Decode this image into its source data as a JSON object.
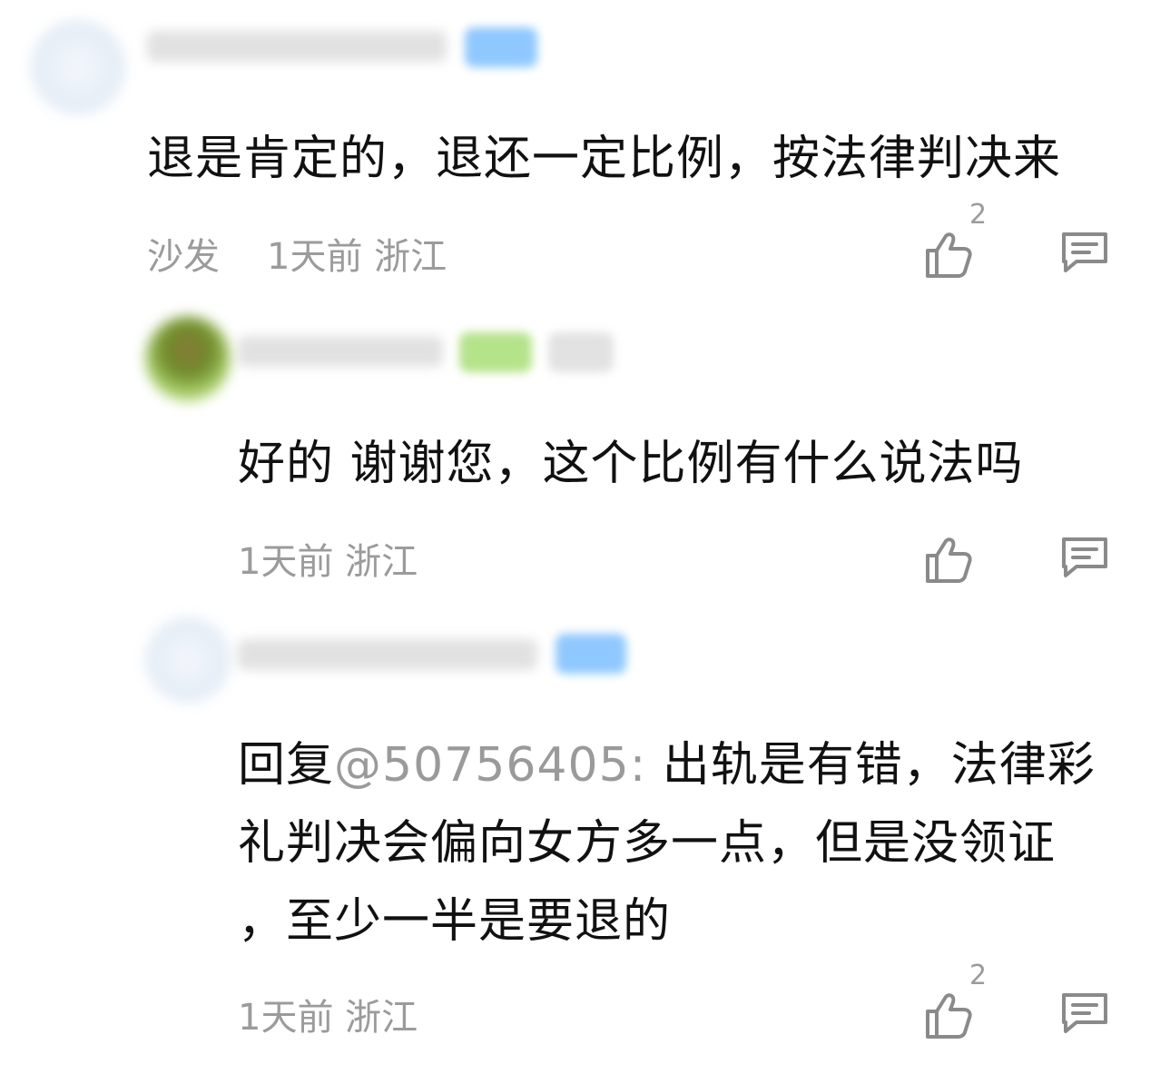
{
  "comments": [
    {
      "text": "退是肯定的，退还一定比例，按法律判决来",
      "reply_tag": "沙发",
      "time": "1天前",
      "location": "浙江",
      "like_count": "2"
    },
    {
      "text": "好的 谢谢您，这个比例有什么说法吗",
      "time": "1天前",
      "location": "浙江",
      "like_count": ""
    },
    {
      "reply_prefix": "回复",
      "mention": "@50756405:",
      "text_line1": " 出轨是有错，法律彩",
      "text_line2": "礼判决会偏向女方多一点，但是没领证",
      "text_line3": "，至少一半是要退的",
      "time": "1天前",
      "location": "浙江",
      "like_count": "2"
    }
  ],
  "icons": {
    "like": "thumbs-up-icon",
    "reply": "comment-icon"
  },
  "colors": {
    "text": "#111111",
    "meta": "#9b9b9b",
    "mention": "#9a9a9a",
    "badge_blue": "#8fc8ff",
    "badge_green": "#b5e38a"
  }
}
